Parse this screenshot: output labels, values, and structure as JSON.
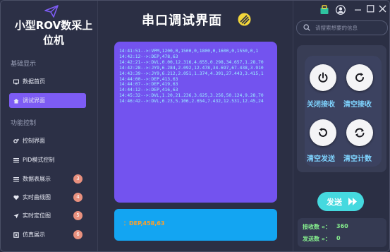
{
  "app": {
    "title": "小型ROV数采上位机"
  },
  "sidebar": {
    "sections": [
      {
        "label": "基础显示"
      },
      {
        "label": "功能控制"
      }
    ],
    "items": [
      {
        "label": "数据首页",
        "icon": "monitor-icon"
      },
      {
        "label": "调试界面",
        "icon": "home-icon"
      },
      {
        "label": "控制界面",
        "icon": "gears-icon"
      },
      {
        "label": "PID模式控制",
        "icon": "menu-icon"
      },
      {
        "label": "数据表展示",
        "icon": "list-icon",
        "badge": "3"
      },
      {
        "label": "实时曲线图",
        "icon": "heart-icon",
        "badge": "4"
      },
      {
        "label": "实时定位图",
        "icon": "location-arrow-icon",
        "badge": "5"
      },
      {
        "label": "仿真展示",
        "icon": "square-icon",
        "badge": "6"
      }
    ]
  },
  "main": {
    "title": "串口调试界面",
    "log_lines": [
      "14:41:51-->:VPM,1200,0,1500,0,1800,0,1600,0,1550,0,1",
      "14:42:12-->:DEP,478,63",
      "14:42:21-->:DVL,0.00,12.316,4.655,0.298,34.657,1.28,70",
      "14:42:28-->:JY9,6.284,2.092,12.478,34.697,67.438,3.910",
      "14:43:39-->:JY9,6.212,2.051,1.374,4.391,27.443,3.415,1",
      "14:44:00-->:DEP,413,63",
      "14:44:07-->:DEP,419,63",
      "14:44:12-->:DEP,416,63",
      "14:45:32-->:DVL,1.20,21.236,3.625,3.256,50.124,9.28,70",
      "14:46:42-->:DVL,6.23,5.106,2.654,7.432,12.531,12.45,24"
    ],
    "send_text": "：DEP,458,63"
  },
  "right": {
    "search_placeholder": "请搜索想要的信息",
    "buttons": [
      {
        "label": "关闭接收",
        "icon": "power-icon"
      },
      {
        "label": "清空接收",
        "icon": "refresh-icon"
      },
      {
        "label": "清空发送",
        "icon": "undo-icon"
      },
      {
        "label": "清空计数",
        "icon": "sync-icon"
      }
    ],
    "send_label": "发送",
    "stats": {
      "recv_label": "接收数 «：",
      "recv_value": "360",
      "send_label": "发送数 »：",
      "send_value": "0"
    }
  },
  "colors": {
    "log_panel": "#7353ef",
    "send_panel": "#13a5f2",
    "active_nav": "#7d5cf4",
    "send_button": "#45d9df",
    "badge": "#e8907e"
  }
}
